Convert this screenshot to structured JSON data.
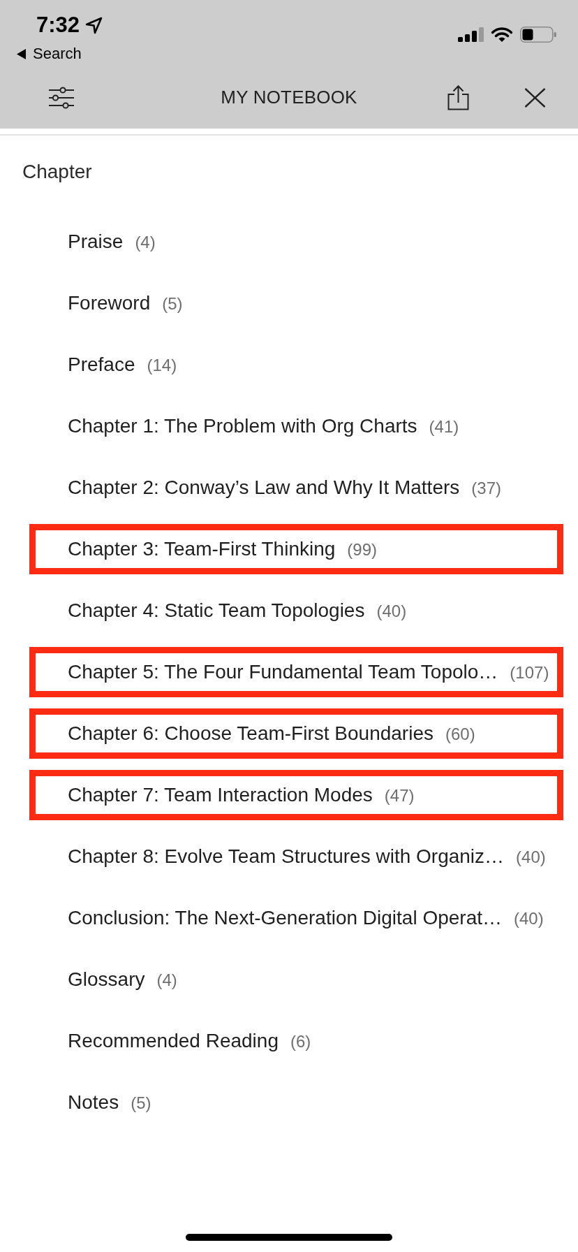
{
  "status_bar": {
    "time": "7:32",
    "back_label": "Search"
  },
  "header": {
    "title": "MY NOTEBOOK"
  },
  "section": {
    "label": "Chapter"
  },
  "chapters": [
    {
      "title": "Praise",
      "count": "(4)",
      "highlighted": false
    },
    {
      "title": "Foreword",
      "count": "(5)",
      "highlighted": false
    },
    {
      "title": "Preface",
      "count": "(14)",
      "highlighted": false
    },
    {
      "title": "Chapter 1: The Problem with Org Charts",
      "count": "(41)",
      "highlighted": false
    },
    {
      "title": "Chapter 2: Conway’s Law and Why It Matters",
      "count": "(37)",
      "highlighted": false
    },
    {
      "title": "Chapter 3: Team-First Thinking",
      "count": "(99)",
      "highlighted": true
    },
    {
      "title": "Chapter 4: Static Team Topologies",
      "count": "(40)",
      "highlighted": false
    },
    {
      "title": "Chapter 5: The Four Fundamental Team Topolo…",
      "count": "(107)",
      "highlighted": true
    },
    {
      "title": "Chapter 6: Choose Team-First Boundaries",
      "count": "(60)",
      "highlighted": true
    },
    {
      "title": "Chapter 7: Team Interaction Modes",
      "count": "(47)",
      "highlighted": true
    },
    {
      "title": "Chapter 8: Evolve Team Structures with Organiz…",
      "count": "(40)",
      "highlighted": false
    },
    {
      "title": "Conclusion: The Next-Generation Digital Operat…",
      "count": "(40)",
      "highlighted": false
    },
    {
      "title": "Glossary",
      "count": "(4)",
      "highlighted": false
    },
    {
      "title": "Recommended Reading",
      "count": "(6)",
      "highlighted": false
    },
    {
      "title": "Notes",
      "count": "(5)",
      "highlighted": false
    }
  ]
}
